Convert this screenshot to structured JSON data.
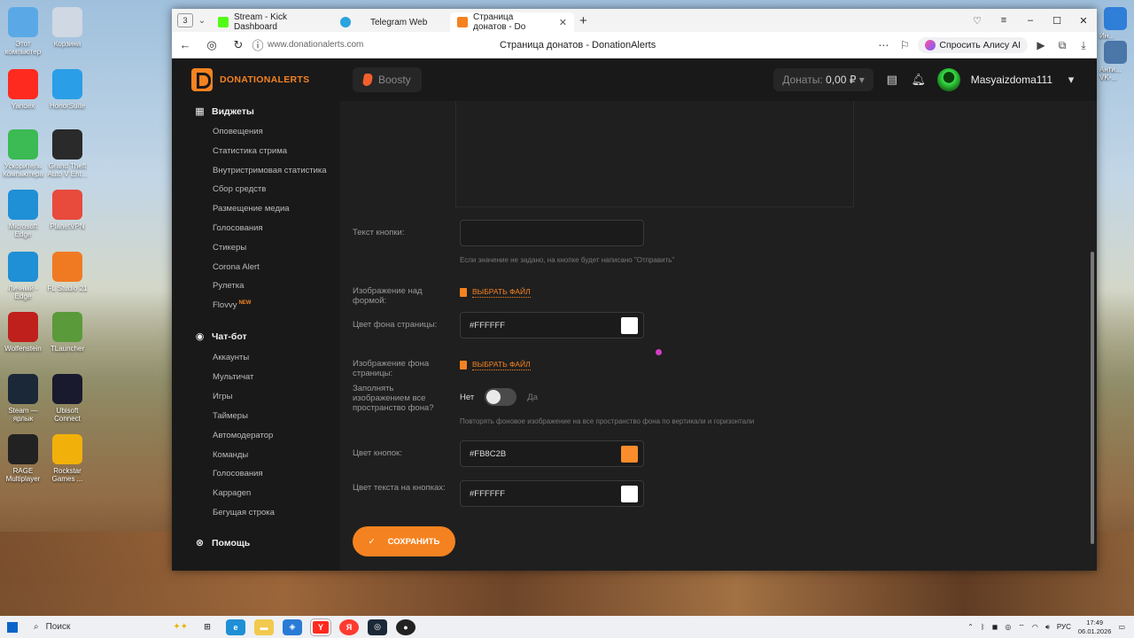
{
  "desktop": {
    "icons": [
      {
        "label": "Этот компьютер",
        "icon": "computer-icon",
        "color": "#5aa9e6"
      },
      {
        "label": "Корзина",
        "icon": "trash-icon",
        "color": "#cfd8e3"
      },
      {
        "label": "Yandex",
        "icon": "yandex-icon",
        "color": "#ff2a1f"
      },
      {
        "label": "HonorSuite",
        "icon": "honor-icon",
        "color": "#2a9ee6"
      },
      {
        "label": "Ускоритель Компьютера",
        "icon": "speedometer-icon",
        "color": "#3cba54"
      },
      {
        "label": "Grand Theft Auto V Ent...",
        "icon": "gta-icon",
        "color": "#2a2a2a"
      },
      {
        "label": "Microsoft Edge",
        "icon": "edge-icon",
        "color": "#1f8fd6"
      },
      {
        "label": "PlanetVPN",
        "icon": "vpn-icon",
        "color": "#e84a3c"
      },
      {
        "label": "Личный - Edge",
        "icon": "edge-icon",
        "color": "#1f8fd6"
      },
      {
        "label": "FL Studio 21",
        "icon": "flstudio-icon",
        "color": "#f07a22"
      },
      {
        "label": "Wolfenstein",
        "icon": "wolfenstein-icon",
        "color": "#c0201c"
      },
      {
        "label": "TLauncher",
        "icon": "minecraft-icon",
        "color": "#5a9a3a"
      },
      {
        "label": "Steam — ярлык",
        "icon": "steam-icon",
        "color": "#1b2838"
      },
      {
        "label": "Ubisoft Connect",
        "icon": "ubisoft-icon",
        "color": "#1a1a2e"
      },
      {
        "label": "RAGE Multiplayer",
        "icon": "rage-icon",
        "color": "#222"
      },
      {
        "label": "Rockstar Games ...",
        "icon": "rockstar-icon",
        "color": "#f2b10a"
      }
    ],
    "right_icons": [
      {
        "label": "Ин...",
        "icon": "app-icon"
      },
      {
        "label": "Анти... VK-...",
        "icon": "app-icon"
      }
    ]
  },
  "browser": {
    "tab_count": "3",
    "tabs": [
      {
        "title": "Stream - Kick Dashboard",
        "favicon_color": "#53fc18",
        "icon": "kick-icon"
      },
      {
        "title": "Telegram Web",
        "favicon_color": "#2aa3df",
        "icon": "telegram-icon"
      },
      {
        "title": "Страница донатов - Do",
        "favicon_color": "#f58220",
        "icon": "donationalerts-icon",
        "active": true
      }
    ],
    "url": "www.donationalerts.com",
    "page_title": "Страница донатов - DonationAlerts",
    "alice_label": "Спросить Алису AI"
  },
  "site": {
    "logo_text": "DONATIONALERTS",
    "boosty_label": "Boosty",
    "donates_label": "Донаты:",
    "donates_value": "0,00 ₽",
    "username": "Masyaizdoma111"
  },
  "sidebar": {
    "widgets_title": "Виджеты",
    "widgets_items": [
      "Оповещения",
      "Статистика стрима",
      "Внутристримовая статистика",
      "Сбор средств",
      "Размещение медиа",
      "Голосования",
      "Стикеры",
      "Corona Alert",
      "Рулетка",
      "Flovvy"
    ],
    "flovvy_badge": "NEW",
    "chatbot_title": "Чат-бот",
    "chatbot_items": [
      "Аккаунты",
      "Мультичат",
      "Игры",
      "Таймеры",
      "Автомодератор",
      "Команды",
      "Голосования",
      "Kappagen",
      "Бегущая строка"
    ],
    "help_title": "Помощь"
  },
  "form": {
    "button_text_label": "Текст кнопки:",
    "button_text_value": "",
    "button_text_hint": "Если значение не задано, на кнопке будет написано \"Отправить\"",
    "header_image_label": "Изображение над формой:",
    "choose_file": "ВЫБРАТЬ ФАЙЛ",
    "bg_color_label": "Цвет фона страницы:",
    "bg_color_value": "#FFFFFF",
    "bg_image_label": "Изображение фона страницы:",
    "fill_label": "Заполнять изображением все пространство фона?",
    "toggle_no": "Нет",
    "toggle_yes": "Да",
    "fill_hint": "Повторять фоновое изображение на все пространство фона по вертикали и горизонтали",
    "btn_color_label": "Цвет кнопок:",
    "btn_color_value": "#FB8C2B",
    "btn_text_color_label": "Цвет текста на кнопках:",
    "btn_text_color_value": "#FFFFFF",
    "save_label": "СОХРАНИТЬ",
    "colors": {
      "bg": "#FFFFFF",
      "btn": "#FB8C2B",
      "btn_text": "#FFFFFF"
    }
  },
  "taskbar": {
    "search_label": "Поиск",
    "lang": "РУС",
    "time": "17:49",
    "date": "06.01.2026"
  }
}
